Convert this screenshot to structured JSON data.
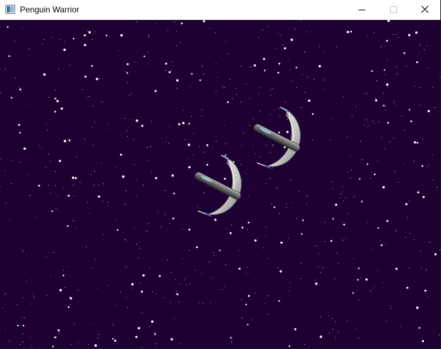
{
  "window": {
    "title": "Penguin Warrior",
    "controls": {
      "minimize_icon": "minimize-icon",
      "maximize_icon": "maximize-icon",
      "close_icon": "close-icon"
    }
  },
  "game": {
    "background_color": "#1f0032",
    "star_color": "#ffffff",
    "ships": [
      {
        "name": "player-ship",
        "icon": "crescent-ship"
      },
      {
        "name": "opponent-ship",
        "icon": "crescent-ship"
      }
    ]
  }
}
